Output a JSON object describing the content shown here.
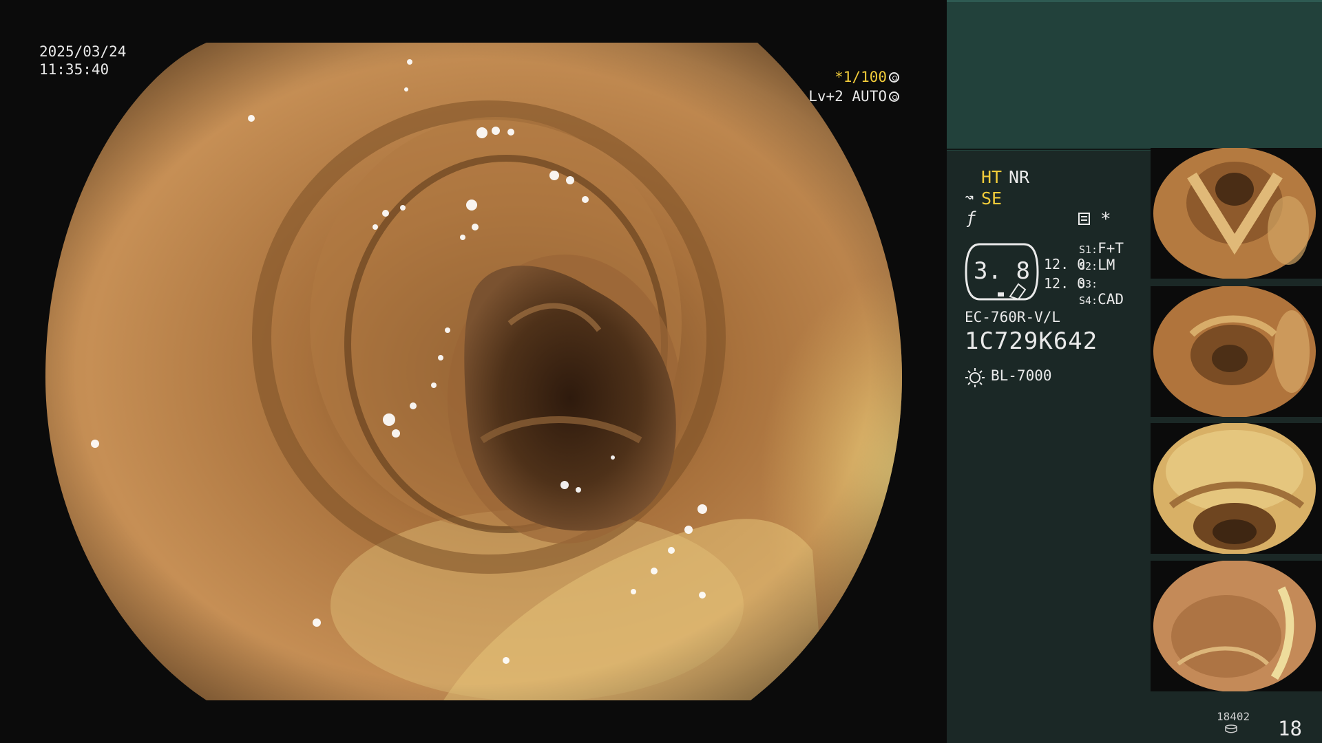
{
  "main": {
    "date": "2025/03/24",
    "time": "11:35:40",
    "shutter_prefix": "*1/100",
    "iris": "Lv+2 AUTO",
    "aperture_icon": "aperture-icon",
    "auto_icon": "auto-exposure-icon"
  },
  "panel": {
    "mode_ht": "HT",
    "mode_nr": "NR",
    "mode_se": "SE",
    "se_icon": "scope-icon",
    "f_icon": "f-icon",
    "settings_icon": "menu-icon",
    "asterisk": "*",
    "gauge_value": "3. 8",
    "value_a": "12. 0",
    "value_b": "12. 0",
    "slots": [
      {
        "key": "S1:",
        "value": "F+T"
      },
      {
        "key": "S2:",
        "value": "LM"
      },
      {
        "key": "S3:",
        "value": ""
      },
      {
        "key": "S4:",
        "value": "CAD"
      }
    ],
    "scope_model": "EC-760R-V/L",
    "serial": "1C729K642",
    "light_icon": "sun-icon",
    "light_model": "BL-7000"
  },
  "footer": {
    "storage_count": "18402",
    "storage_icon": "storage-icon",
    "page_number": "18"
  },
  "colors": {
    "accent_yellow": "#f2cc3a",
    "panel_background": "#1b2826",
    "panel_header": "#22413b"
  }
}
